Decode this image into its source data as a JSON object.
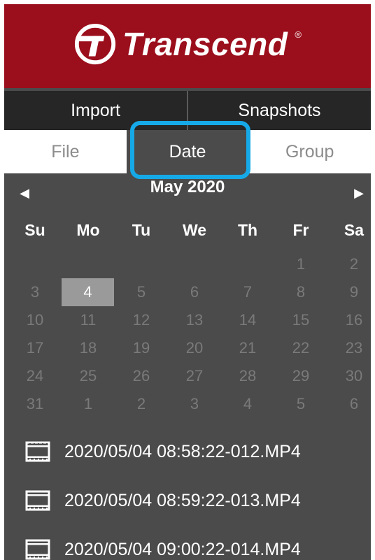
{
  "brand": {
    "name": "Transcend",
    "trademark": "®",
    "color": "#9b0e1c"
  },
  "nav": {
    "tabs": [
      "Import",
      "Snapshots"
    ]
  },
  "subtabs": [
    "File",
    "Date",
    "Group"
  ],
  "calendar": {
    "month_label": "May 2020",
    "prev_icon": "triangle-left-icon",
    "next_icon": "triangle-right-icon",
    "weekdays": [
      "Su",
      "Mo",
      "Tu",
      "We",
      "Th",
      "Fr",
      "Sa"
    ],
    "weeks": [
      [
        "",
        "",
        "",
        "",
        "",
        "1",
        "2"
      ],
      [
        "3",
        "4",
        "5",
        "6",
        "7",
        "8",
        "9"
      ],
      [
        "10",
        "11",
        "12",
        "13",
        "14",
        "15",
        "16"
      ],
      [
        "17",
        "18",
        "19",
        "20",
        "21",
        "22",
        "23"
      ],
      [
        "24",
        "25",
        "26",
        "27",
        "28",
        "29",
        "30"
      ],
      [
        "31",
        "1",
        "2",
        "3",
        "4",
        "5",
        "6"
      ]
    ],
    "selected_day": "4"
  },
  "files": [
    {
      "icon": "film-icon",
      "name": "2020/05/04 08:58:22-012.MP4"
    },
    {
      "icon": "film-icon",
      "name": "2020/05/04 08:59:22-013.MP4"
    },
    {
      "icon": "film-icon",
      "name": "2020/05/04 09:00:22-014.MP4"
    }
  ],
  "colors": {
    "highlight": "#16a9e8",
    "panel": "#4b4b4b",
    "nav": "#262626"
  }
}
